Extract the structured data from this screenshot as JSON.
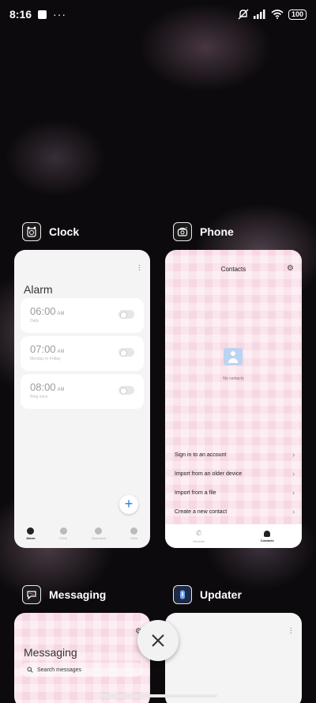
{
  "status_bar": {
    "time": "8:16",
    "dots": "···",
    "battery": "100"
  },
  "apps": {
    "clock": {
      "label": "Clock",
      "title": "Alarm",
      "alarms": [
        {
          "time": "06:00",
          "ampm": "AM",
          "sub": "Daily"
        },
        {
          "time": "07:00",
          "ampm": "AM",
          "sub": "Monday to Friday"
        },
        {
          "time": "08:00",
          "ampm": "AM",
          "sub": "Ring once"
        }
      ],
      "fab": "+",
      "nav": [
        "Alarm",
        "Clock",
        "Stopwatch",
        "Timer"
      ]
    },
    "phone": {
      "label": "Phone",
      "title": "Contacts",
      "empty_text": "No contacts",
      "actions": [
        "Sign in to an account",
        "Import from an older device",
        "Import from a file",
        "Create a new contact"
      ],
      "nav": [
        "Recents",
        "Contacts"
      ]
    },
    "messaging": {
      "label": "Messaging",
      "title": "Messaging",
      "search_placeholder": "Search messages"
    },
    "updater": {
      "label": "Updater"
    }
  },
  "icons": {
    "close": "×",
    "chevron": "›",
    "gear": "⚙",
    "kebab": "⋮"
  }
}
